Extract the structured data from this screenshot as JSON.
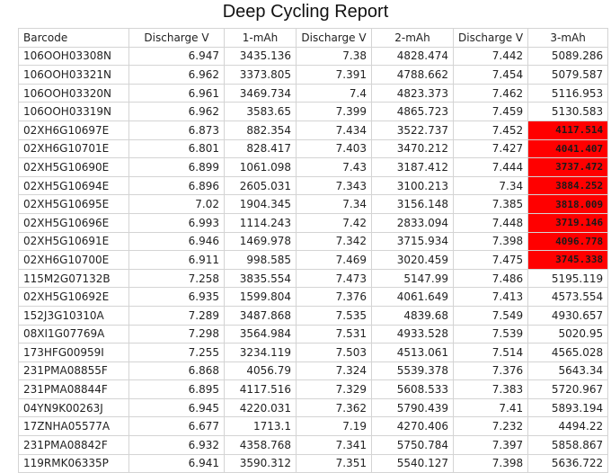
{
  "report": {
    "title": "Deep Cycling Report"
  },
  "columns": [
    "Barcode",
    "Discharge V",
    "1-mAh",
    "Discharge V",
    "2-mAh",
    "Discharge V",
    "3-mAh"
  ],
  "highlight_color": "#ff0000",
  "rows": [
    {
      "cells": [
        "106OOH03308N",
        "6.947",
        "3435.136",
        "7.38",
        "4828.474",
        "7.442",
        "5089.286"
      ],
      "flag": false
    },
    {
      "cells": [
        "106OOH03321N",
        "6.962",
        "3373.805",
        "7.391",
        "4788.662",
        "7.454",
        "5079.587"
      ],
      "flag": false
    },
    {
      "cells": [
        "106OOH03320N",
        "6.961",
        "3469.734",
        "7.4",
        "4823.373",
        "7.462",
        "5116.953"
      ],
      "flag": false
    },
    {
      "cells": [
        "106OOH03319N",
        "6.962",
        "3583.65",
        "7.399",
        "4865.723",
        "7.459",
        "5130.583"
      ],
      "flag": false
    },
    {
      "cells": [
        "02XH6G10697E",
        "6.873",
        "882.354",
        "7.434",
        "3522.737",
        "7.452",
        "4117.514"
      ],
      "flag": true
    },
    {
      "cells": [
        "02XH6G10701E",
        "6.801",
        "828.417",
        "7.403",
        "3470.212",
        "7.427",
        "4041.407"
      ],
      "flag": true
    },
    {
      "cells": [
        "02XH5G10690E",
        "6.899",
        "1061.098",
        "7.43",
        "3187.412",
        "7.444",
        "3737.472"
      ],
      "flag": true
    },
    {
      "cells": [
        "02XH5G10694E",
        "6.896",
        "2605.031",
        "7.343",
        "3100.213",
        "7.34",
        "3884.252"
      ],
      "flag": true
    },
    {
      "cells": [
        "02XH5G10695E",
        "7.02",
        "1904.345",
        "7.34",
        "3156.148",
        "7.385",
        "3818.009"
      ],
      "flag": true
    },
    {
      "cells": [
        "02XH5G10696E",
        "6.993",
        "1114.243",
        "7.42",
        "2833.094",
        "7.448",
        "3719.146"
      ],
      "flag": true
    },
    {
      "cells": [
        "02XH5G10691E",
        "6.946",
        "1469.978",
        "7.342",
        "3715.934",
        "7.398",
        "4096.778"
      ],
      "flag": true
    },
    {
      "cells": [
        "02XH6G10700E",
        "6.911",
        "998.585",
        "7.469",
        "3020.459",
        "7.475",
        "3745.338"
      ],
      "flag": true
    },
    {
      "cells": [
        "115M2G07132B",
        "7.258",
        "3835.554",
        "7.473",
        "5147.99",
        "7.486",
        "5195.119"
      ],
      "flag": false
    },
    {
      "cells": [
        "02XH5G10692E",
        "6.935",
        "1599.804",
        "7.376",
        "4061.649",
        "7.413",
        "4573.554"
      ],
      "flag": false
    },
    {
      "cells": [
        "152J3G10310A",
        "7.289",
        "3487.868",
        "7.535",
        "4839.68",
        "7.549",
        "4930.657"
      ],
      "flag": false
    },
    {
      "cells": [
        "08XI1G07769A",
        "7.298",
        "3564.984",
        "7.531",
        "4933.528",
        "7.539",
        "5020.95"
      ],
      "flag": false
    },
    {
      "cells": [
        "173HFG00959I",
        "7.255",
        "3234.119",
        "7.503",
        "4513.061",
        "7.514",
        "4565.028"
      ],
      "flag": false
    },
    {
      "cells": [
        "231PMA08855F",
        "6.868",
        "4056.79",
        "7.324",
        "5539.378",
        "7.376",
        "5643.34"
      ],
      "flag": false
    },
    {
      "cells": [
        "231PMA08844F",
        "6.895",
        "4117.516",
        "7.329",
        "5608.533",
        "7.383",
        "5720.967"
      ],
      "flag": false
    },
    {
      "cells": [
        "04YN9K00263J",
        "6.945",
        "4220.031",
        "7.362",
        "5790.439",
        "7.41",
        "5893.194"
      ],
      "flag": false
    },
    {
      "cells": [
        "17ZNHA05577A",
        "6.677",
        "1713.1",
        "7.19",
        "4270.406",
        "7.232",
        "4494.22"
      ],
      "flag": false
    },
    {
      "cells": [
        "231PMA08842F",
        "6.932",
        "4358.768",
        "7.341",
        "5750.784",
        "7.397",
        "5858.867"
      ],
      "flag": false
    },
    {
      "cells": [
        "119RMK06335P",
        "6.941",
        "3590.312",
        "7.351",
        "5540.127",
        "7.398",
        "5636.722"
      ],
      "flag": false
    }
  ]
}
